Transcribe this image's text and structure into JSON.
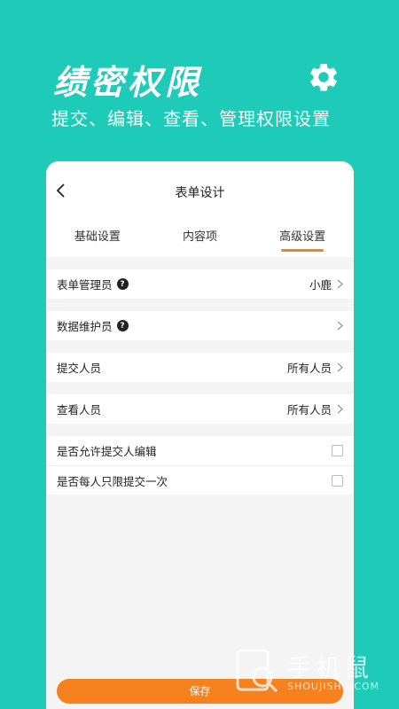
{
  "hero": {
    "title": "绩密权限",
    "subtitle": "提交、编辑、查看、管理权限设置",
    "gear_icon": "gear-icon"
  },
  "colors": {
    "background": "#1ecbb8",
    "accent": "#f5821f"
  },
  "nav": {
    "title": "表单设计",
    "back_icon": "chevron-left-icon"
  },
  "tabs": [
    {
      "label": "基础设置",
      "active": false
    },
    {
      "label": "内容项",
      "active": false
    },
    {
      "label": "高级设置",
      "active": true
    }
  ],
  "settings": {
    "form_admin": {
      "label": "表单管理员",
      "value": "小鹿"
    },
    "data_maintainer": {
      "label": "数据维护员",
      "value": ""
    },
    "submitters": {
      "label": "提交人员",
      "value": "所有人员"
    },
    "viewers": {
      "label": "查看人员",
      "value": "所有人员"
    },
    "allow_submitter_edit": {
      "label": "是否允许提交人编辑",
      "checked": false
    },
    "submit_once": {
      "label": "是否每人只限提交一次",
      "checked": false
    }
  },
  "help_glyph": "?",
  "save_label": "保存",
  "watermark": {
    "text": "手机鼠",
    "sub": "SHOUJISHU.COM"
  }
}
